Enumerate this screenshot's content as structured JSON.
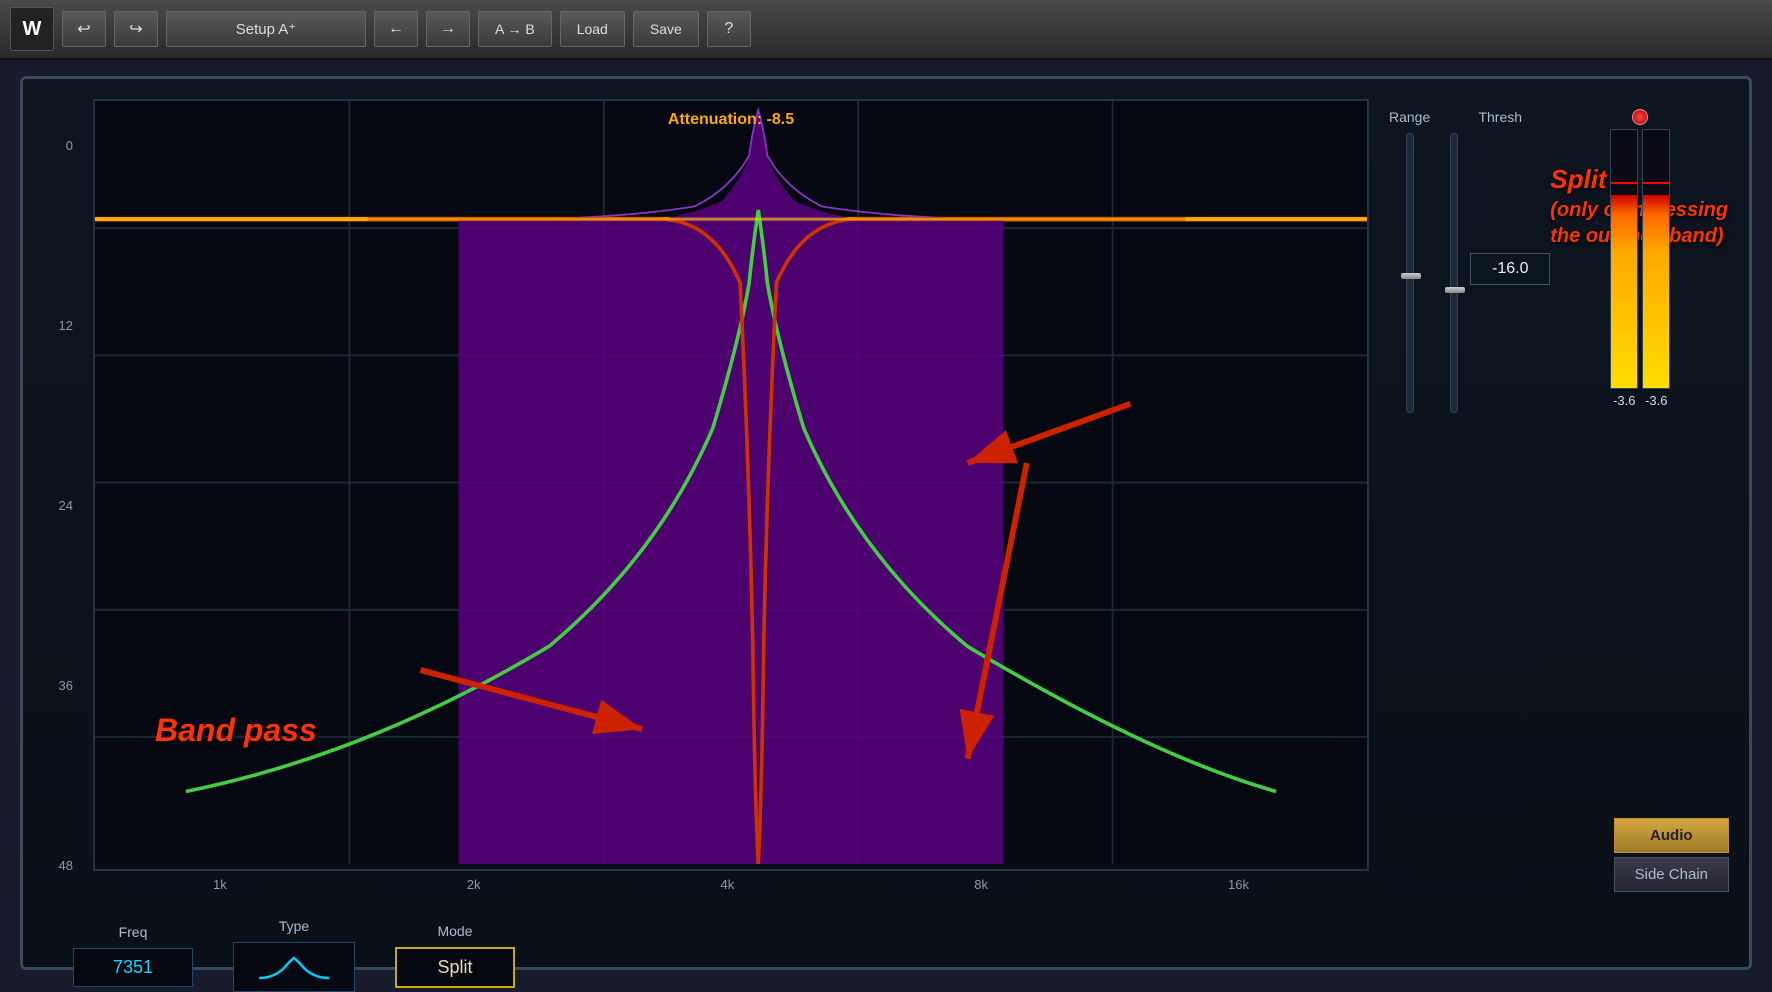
{
  "toolbar": {
    "logo": "W",
    "undo_label": "↩",
    "redo_label": "↪",
    "setup_label": "Setup A⁺",
    "prev_label": "←",
    "next_label": "→",
    "ab_label": "A → B",
    "load_label": "Load",
    "save_label": "Save",
    "help_label": "?"
  },
  "eq_display": {
    "attenuation_label": "Attenuation: -8.5",
    "y_labels": [
      "0",
      "12",
      "24",
      "36",
      "48"
    ],
    "x_labels": [
      "1k",
      "2k",
      "4k",
      "8k",
      "16k"
    ]
  },
  "controls": {
    "range_label": "Range",
    "thresh_label": "Thresh",
    "thresh_value": "-16.0",
    "freq_label": "Freq",
    "freq_value": "7351",
    "type_label": "Type",
    "mode_label": "Mode",
    "mode_value": "Split",
    "vu_value1": "-3.6",
    "vu_value2": "-3.6"
  },
  "annotations": {
    "bandpass_label": "Band pass",
    "split_line1": "Split",
    "split_line2": "(only compressing",
    "split_line3": "the outlined band)"
  },
  "audio_sidechain": {
    "audio_label": "Audio",
    "sidechain_label": "Side Chain"
  }
}
